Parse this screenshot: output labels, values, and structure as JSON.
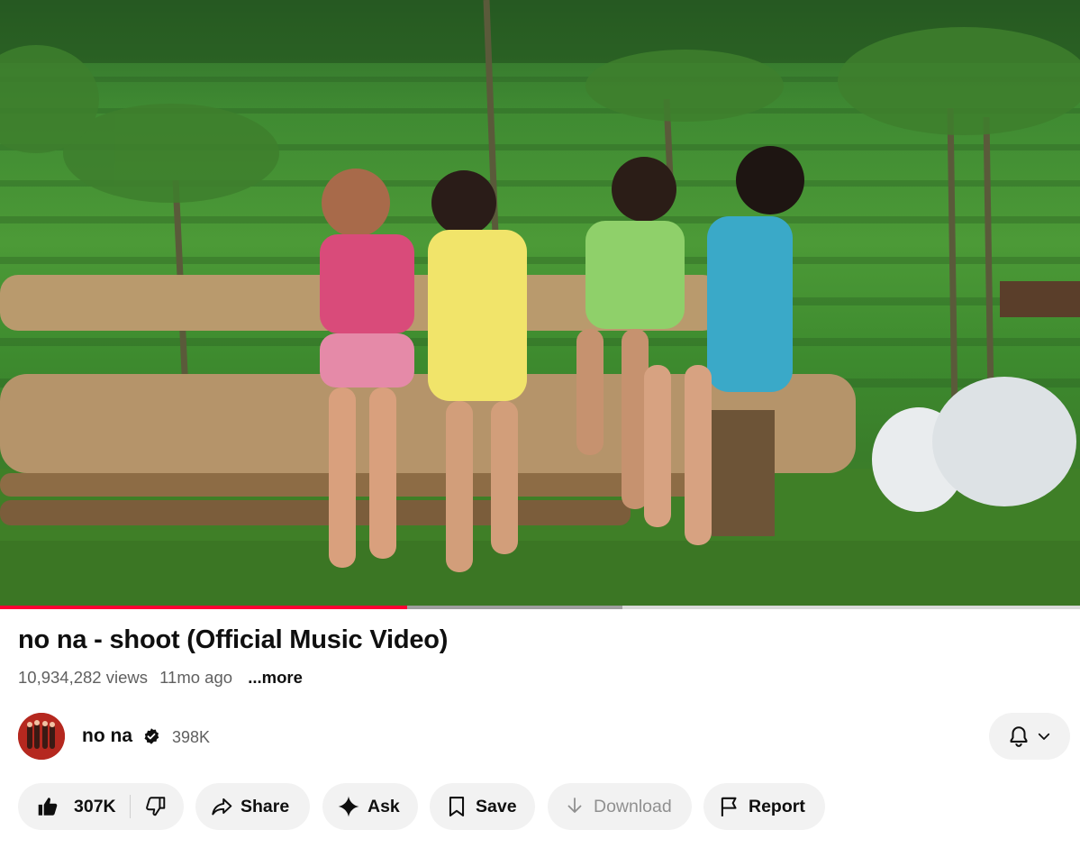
{
  "video": {
    "progress_played": 0.377,
    "progress_buffered": 0.576,
    "colors": {
      "played": "#ff0033",
      "buffered": "#9e9e9e",
      "track": "#d9d9d9"
    }
  },
  "title": "no na - shoot (Official Music Video)",
  "meta": {
    "views": "10,934,282 views",
    "age": "11mo ago",
    "more": "...more"
  },
  "channel": {
    "name": "no na",
    "verified": true,
    "subscribers": "398K",
    "icons": {
      "verified": "verified-check-icon",
      "bell": "bell-icon",
      "chevron": "chevron-down-icon"
    }
  },
  "actions": {
    "like_count": "307K",
    "share": "Share",
    "ask": "Ask",
    "save": "Save",
    "download": "Download",
    "report": "Report",
    "icons": {
      "like": "thumbs-up-icon",
      "dislike": "thumbs-down-icon",
      "share": "share-arrow-icon",
      "ask": "sparkle-icon",
      "save": "bookmark-icon",
      "download": "download-arrow-icon",
      "report": "flag-icon"
    }
  }
}
